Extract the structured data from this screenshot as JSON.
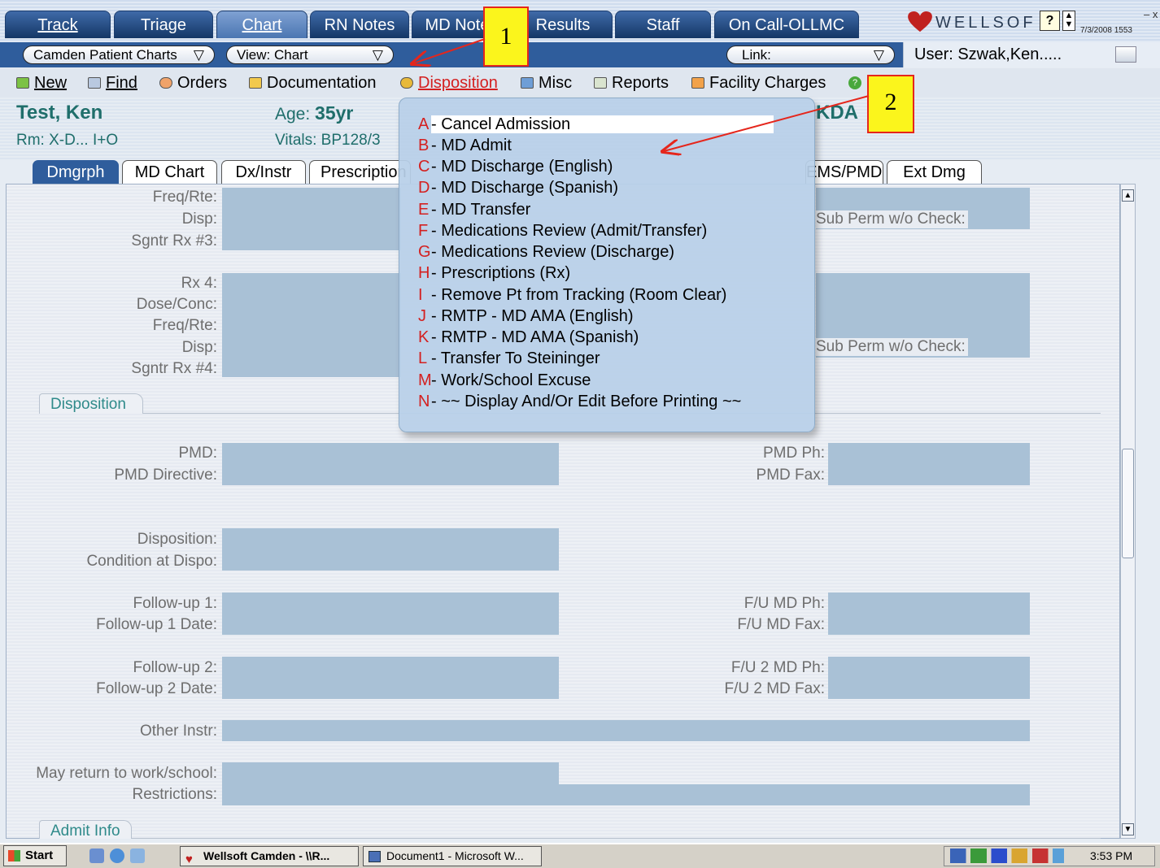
{
  "app": {
    "brand": "WELLSOF",
    "date_time": "7/3/2008 1553",
    "user": "User: Szwak,Ken....."
  },
  "main_tabs": [
    {
      "label": "Track"
    },
    {
      "label": "Triage"
    },
    {
      "label": "Chart",
      "active": true
    },
    {
      "label": "RN Notes"
    },
    {
      "label": "MD Notes"
    },
    {
      "label": "Results"
    },
    {
      "label": "Staff"
    },
    {
      "label": "On Call-OLLMC"
    }
  ],
  "bar": {
    "patient_charts": "Camden Patient Charts",
    "view": "View: Chart",
    "link": "Link:"
  },
  "toolbar": {
    "new": "New",
    "find": "Find",
    "orders": "Orders",
    "documentation": "Documentation",
    "disposition": "Disposition",
    "misc": "Misc",
    "reports": "Reports",
    "facility_charges": "Facility Charges"
  },
  "patient": {
    "name": "Test, Ken",
    "age_label": "Age:",
    "age": "35yr",
    "room": "Rm: X-D...  I+O",
    "vitals": "Vitals: BP128/3",
    "allergy": "KDA"
  },
  "sub_tabs": [
    {
      "label": "Dmgrph",
      "active": true
    },
    {
      "label": "MD Chart"
    },
    {
      "label": "Dx/Instr"
    },
    {
      "label": "Prescription"
    },
    {
      "label": "EMS/PMD"
    },
    {
      "label": "Ext Dmg"
    }
  ],
  "rx": {
    "freq_rte": "Freq/Rte:",
    "disp": "Disp:",
    "sgntr3": "Sgntr Rx #3:",
    "rx4": "Rx 4:",
    "dose_conc": "Dose/Conc:",
    "freq_rte2": "Freq/Rte:",
    "disp2": "Disp:",
    "sgntr4": "Sgntr Rx #4:",
    "sub_perm": "Sub Perm w/o Check:",
    "sub_perm2": "Sub Perm w/o Check:"
  },
  "disposition_section": {
    "title": "Disposition",
    "pmd": "PMD:",
    "pmd_directive": "PMD Directive:",
    "pmd_ph": "PMD Ph:",
    "pmd_fax": "PMD Fax:",
    "disposition": "Disposition:",
    "condition": "Condition at Dispo:",
    "followup1": "Follow-up 1:",
    "followup1_date": "Follow-up 1 Date:",
    "fu_md_ph": "F/U MD Ph:",
    "fu_md_fax": "F/U MD Fax:",
    "followup2": "Follow-up 2:",
    "followup2_date": "Follow-up 2 Date:",
    "fu2_md_ph": "F/U 2 MD Ph:",
    "fu2_md_fax": "F/U 2 MD Fax:",
    "other_instr": "Other Instr:",
    "may_return": "May return to work/school:",
    "restrictions": "Restrictions:"
  },
  "admit_section": {
    "title": "Admit Info"
  },
  "disposition_menu": [
    {
      "key": "A",
      "label": "- Cancel Admission"
    },
    {
      "key": "B",
      "label": "- MD Admit"
    },
    {
      "key": "C",
      "label": "- MD Discharge (English)"
    },
    {
      "key": "D",
      "label": "- MD Discharge (Spanish)"
    },
    {
      "key": "E",
      "label": "- MD Transfer"
    },
    {
      "key": "F",
      "label": "- Medications Review (Admit/Transfer)"
    },
    {
      "key": "G",
      "label": "- Medications Review (Discharge)"
    },
    {
      "key": "H",
      "label": "- Prescriptions (Rx)"
    },
    {
      "key": "I",
      "label": "- Remove Pt from Tracking (Room Clear)"
    },
    {
      "key": "J",
      "label": "- RMTP - MD AMA (English)"
    },
    {
      "key": "K",
      "label": "- RMTP - MD AMA (Spanish)"
    },
    {
      "key": "L",
      "label": "- Transfer To Steininger"
    },
    {
      "key": "M",
      "label": "- Work/School Excuse"
    },
    {
      "key": "N",
      "label": "- ~~ Display And/Or Edit Before Printing ~~"
    }
  ],
  "callouts": {
    "one": "1",
    "two": "2"
  },
  "taskbar": {
    "start": "Start",
    "task1": "Wellsoft Camden - \\\\R...",
    "task2": "Document1 - Microsoft W...",
    "clock": "3:53 PM"
  },
  "colors": {
    "tab_blue": "#2f5d9c",
    "field": "#a9c1d6",
    "menu_key": "#d42020",
    "callout": "#fbf51c",
    "arrow": "#e5261c"
  }
}
